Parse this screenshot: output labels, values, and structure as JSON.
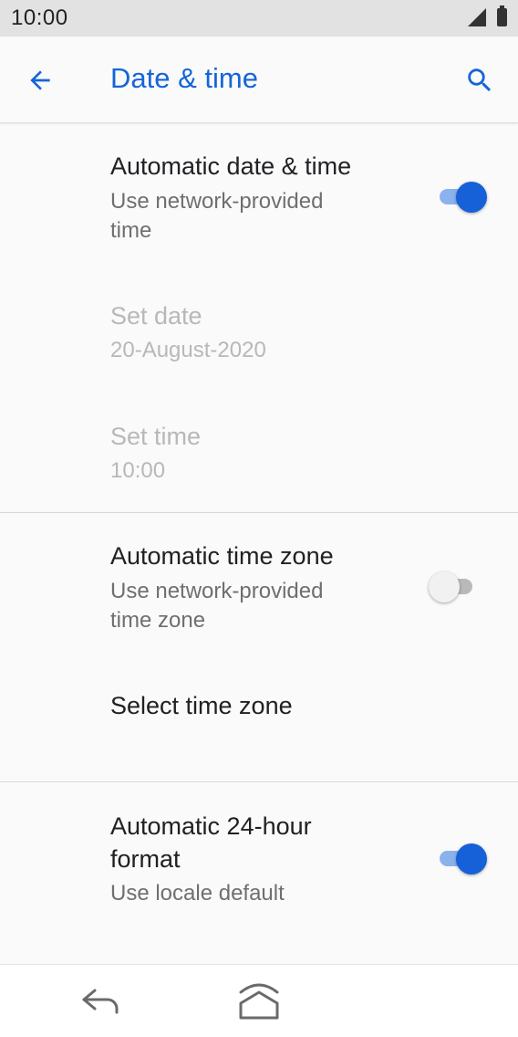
{
  "status_bar": {
    "time": "10:00"
  },
  "app_bar": {
    "title": "Date & time"
  },
  "preferences": {
    "auto_datetime": {
      "title": "Automatic date & time",
      "summary_line1": "Use network-provided",
      "summary_line2": "time",
      "enabled": true
    },
    "set_date": {
      "title": "Set date",
      "summary": "20-August-2020"
    },
    "set_time": {
      "title": "Set time",
      "summary": "10:00"
    },
    "auto_timezone": {
      "title": "Automatic time zone",
      "summary_line1": "Use network-provided",
      "summary_line2": "time zone",
      "enabled": false
    },
    "select_timezone": {
      "title": "Select time zone"
    },
    "auto_24h": {
      "title_line1": "Automatic 24-hour",
      "title_line2": "format",
      "summary": "Use locale default",
      "enabled": true
    }
  },
  "colors": {
    "accent": "#1660d8",
    "title_color": "#1565d8",
    "status_bar_bg": "#e2e2e2"
  }
}
